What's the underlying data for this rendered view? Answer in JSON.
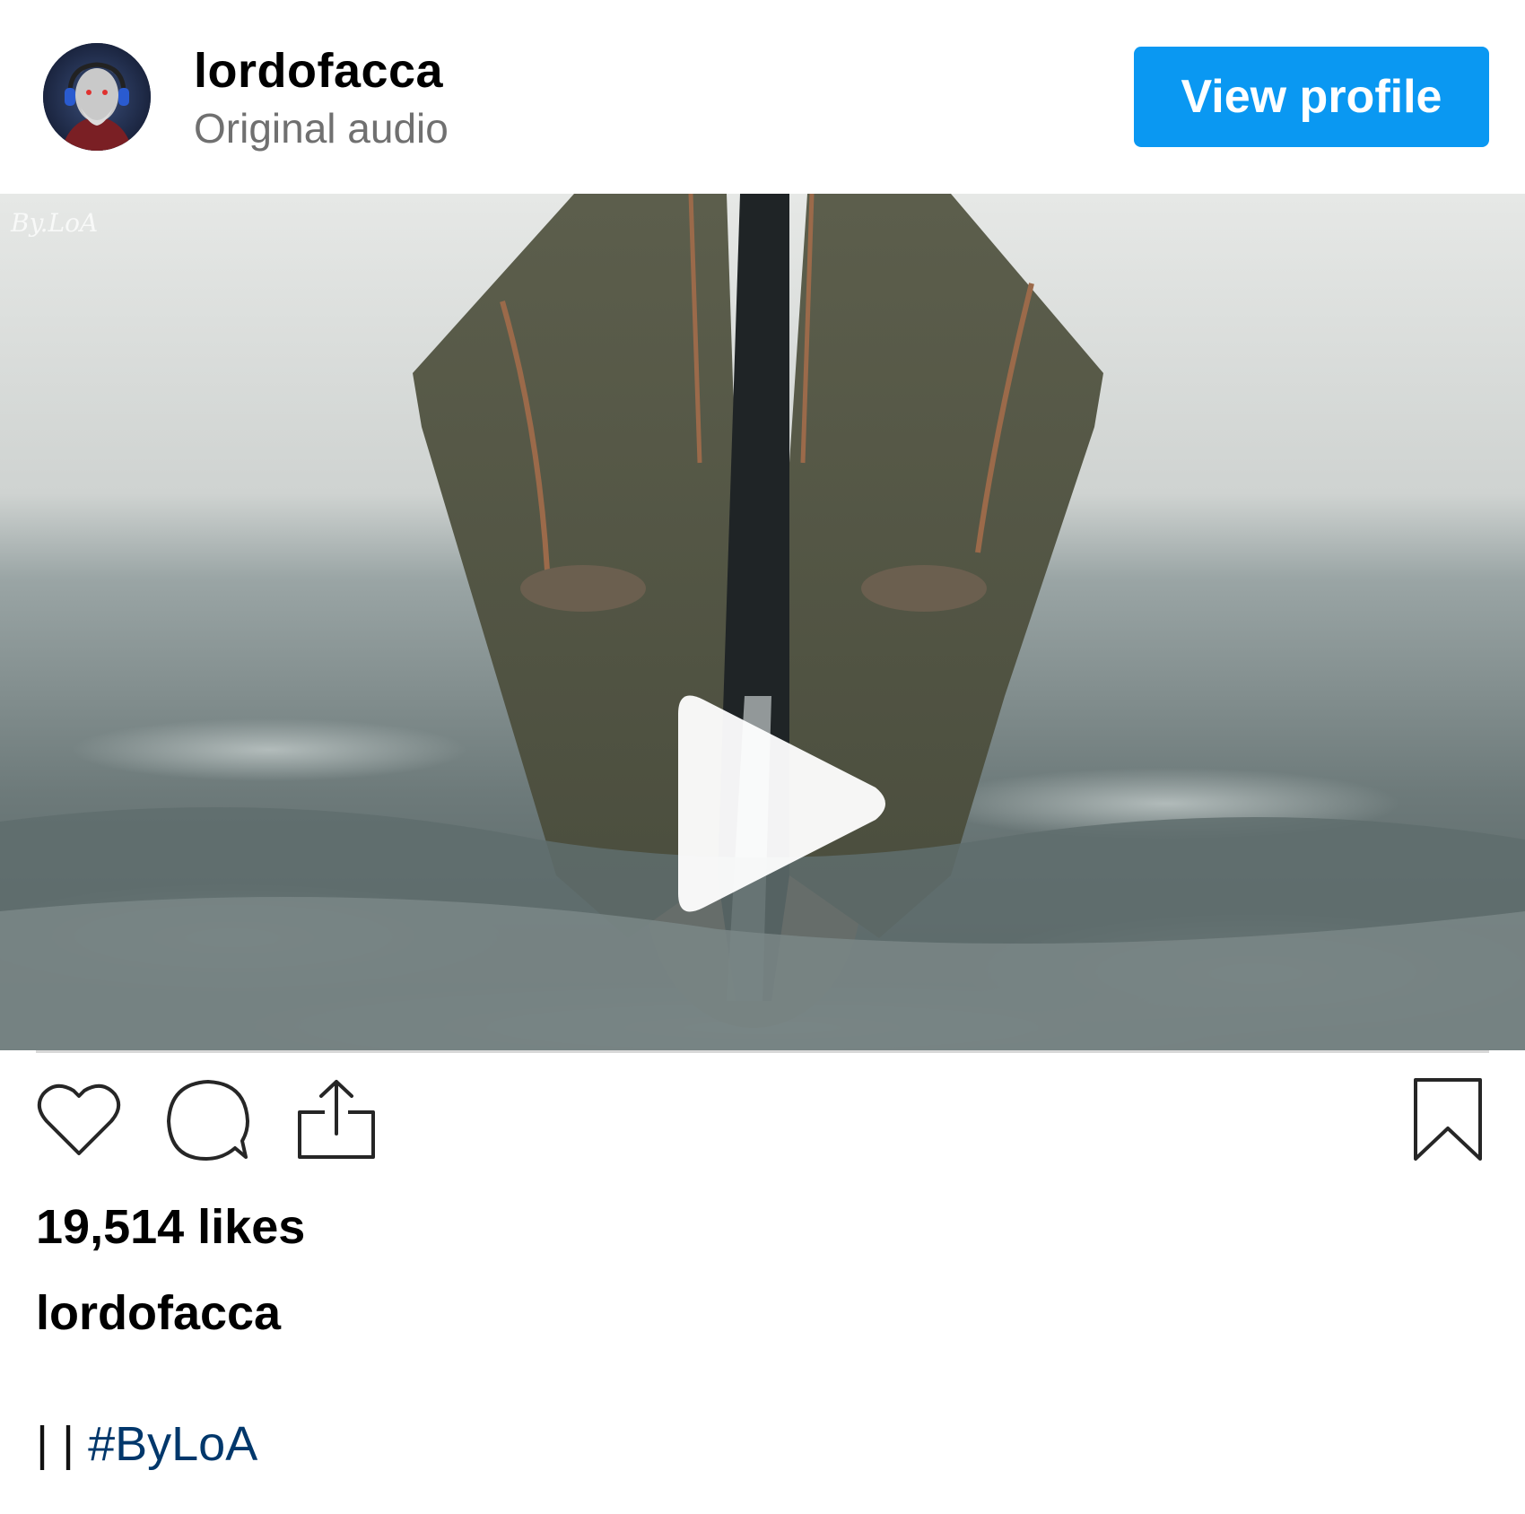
{
  "post": {
    "username": "lordofacca",
    "audio": "Original audio",
    "view_profile_label": "View profile",
    "watermark": "By.LoA",
    "likes": "19,514 likes",
    "caption_user": "lordofacca",
    "caption_separator": "| |",
    "hashtag": "#ByLoA"
  },
  "icons": {
    "avatar": "avatar-image",
    "play": "play-icon",
    "like": "heart-icon",
    "comment": "comment-icon",
    "share": "share-icon",
    "save": "bookmark-icon"
  },
  "colors": {
    "accent": "#0a98f2",
    "hashtag": "#00376b",
    "secondary_text": "#707070"
  }
}
